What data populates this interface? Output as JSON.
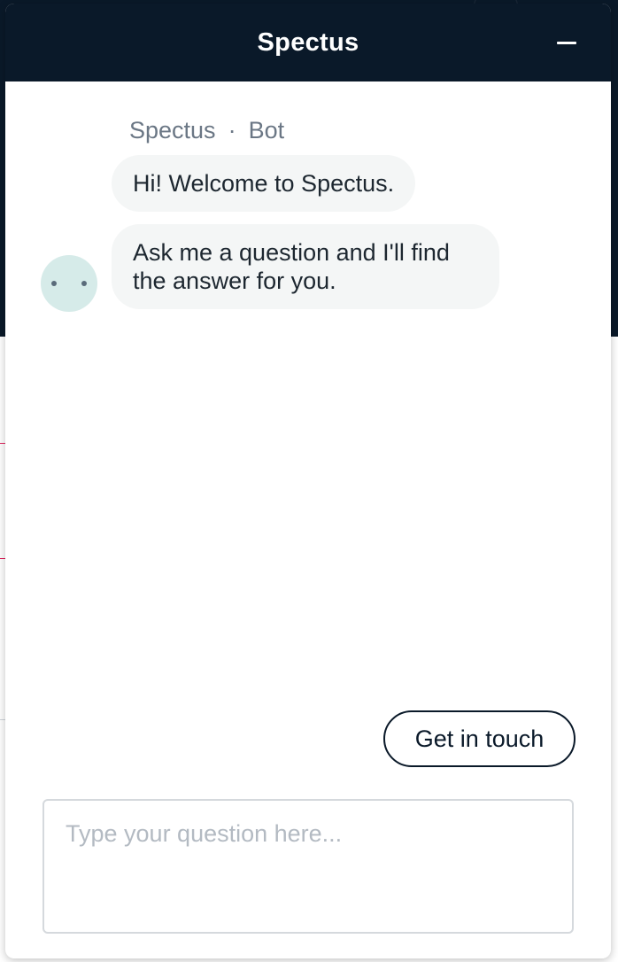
{
  "widget": {
    "title": "Spectus"
  },
  "chat": {
    "sender_name": "Spectus",
    "separator": "·",
    "sender_role": "Bot",
    "messages": [
      {
        "text": "Hi! Welcome to Spectus."
      },
      {
        "text": "Ask me a question and I'll find the answer for you."
      }
    ]
  },
  "actions": {
    "get_in_touch_label": "Get in touch"
  },
  "composer": {
    "placeholder": "Type your question here...",
    "value": ""
  },
  "colors": {
    "header_bg": "#0a1929",
    "bubble_bg": "#f4f6f6",
    "avatar_bg": "#d6ebe9"
  },
  "icons": {
    "minimize": "minimize-icon",
    "avatar": "bot-avatar-icon"
  }
}
